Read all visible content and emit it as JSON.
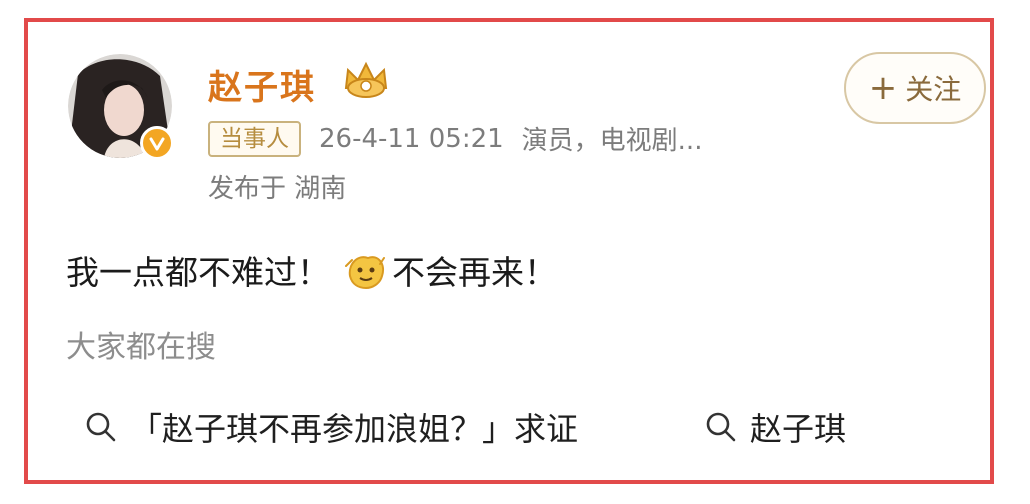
{
  "post": {
    "username": "赵子琪",
    "follow_label": "关注",
    "party_badge": "当事人",
    "timestamp": "26-4-11 05:21",
    "description": "演员，电视剧...",
    "location": "发布于 湖南",
    "text_before": "我一点都不难过！",
    "text_after": "不会再来！"
  },
  "search": {
    "heading": "大家都在搜",
    "items": [
      "「赵子琪不再参加浪姐？」求证",
      "赵子琪"
    ]
  },
  "icons": {
    "verified": "verified-badge-icon",
    "crown": "crown-icon",
    "emoji": "yellow-emoji-icon",
    "search": "search-icon"
  },
  "colors": {
    "frame_border": "#e24a4a",
    "username": "#d9751c",
    "meta_text": "#7c7c7c",
    "badge_border": "#c9b27d"
  }
}
